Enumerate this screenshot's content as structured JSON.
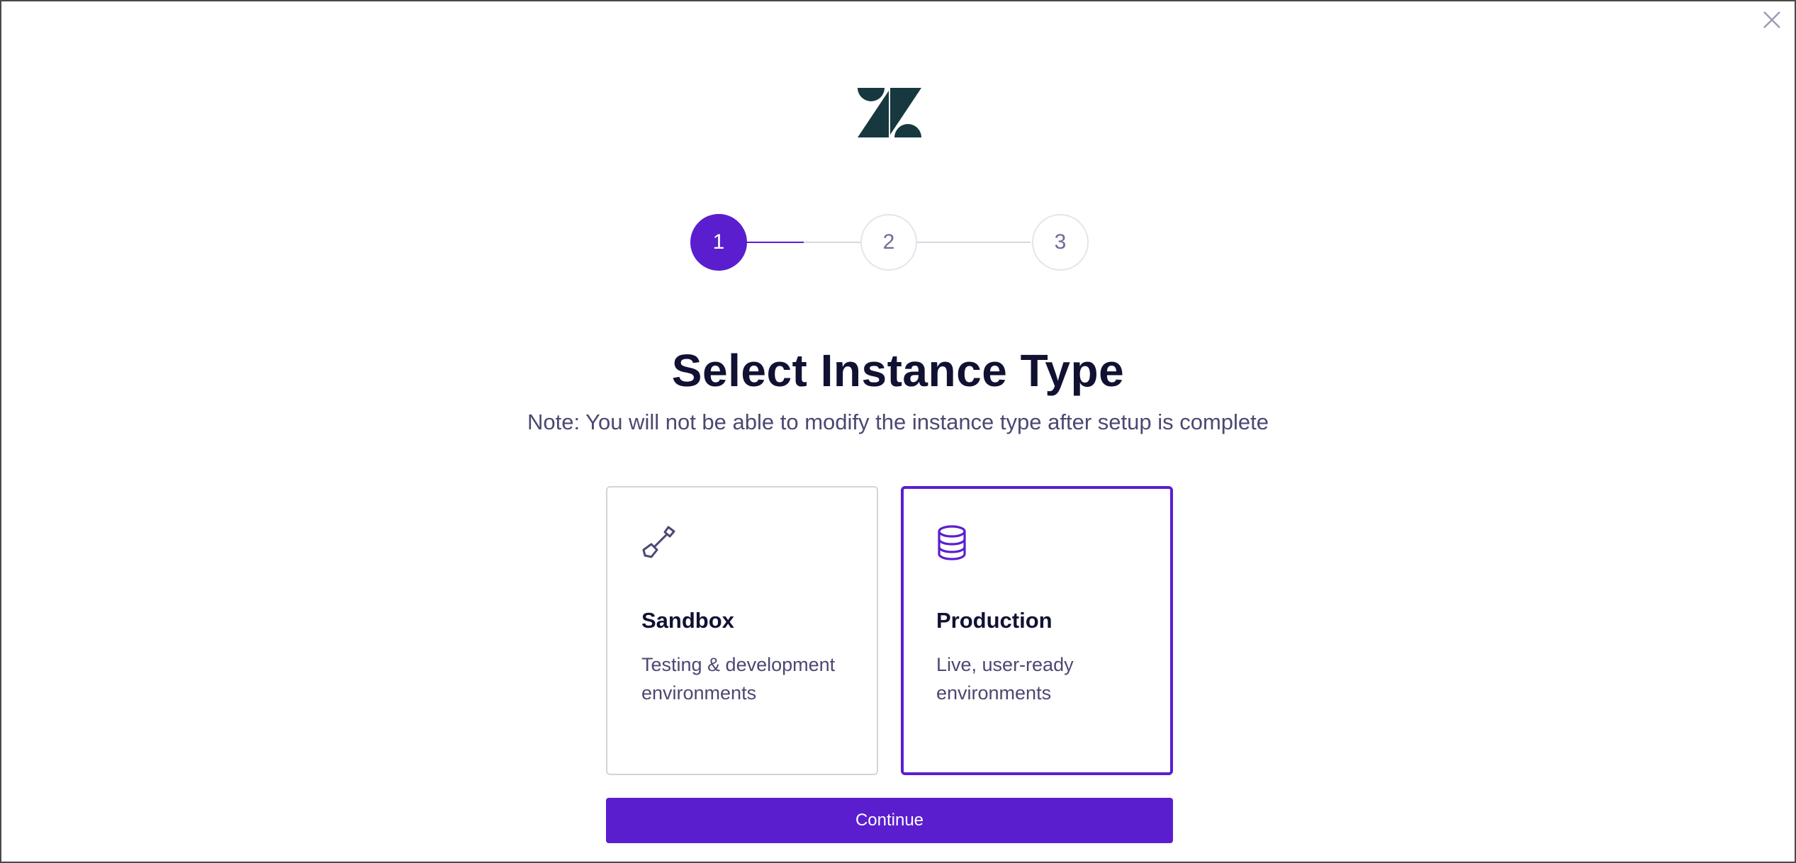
{
  "colors": {
    "accent": "#5a1ecf",
    "logo": "#17383f",
    "title": "#111133",
    "muted_text": "#4b4872"
  },
  "header": {
    "close_icon": "close-icon",
    "logo_icon": "zendesk-logo"
  },
  "stepper": {
    "steps": [
      {
        "label": "1",
        "state": "active"
      },
      {
        "label": "2",
        "state": "inactive"
      },
      {
        "label": "3",
        "state": "inactive"
      }
    ]
  },
  "main": {
    "title": "Select Instance Type",
    "note": "Note: You will not be able to modify the instance type after setup is complete",
    "options": [
      {
        "icon": "shovel-icon",
        "title": "Sandbox",
        "description": "Testing & development environments",
        "selected": false
      },
      {
        "icon": "database-icon",
        "title": "Production",
        "description": "Live, user-ready environments",
        "selected": true
      }
    ],
    "continue_label": "Continue"
  }
}
